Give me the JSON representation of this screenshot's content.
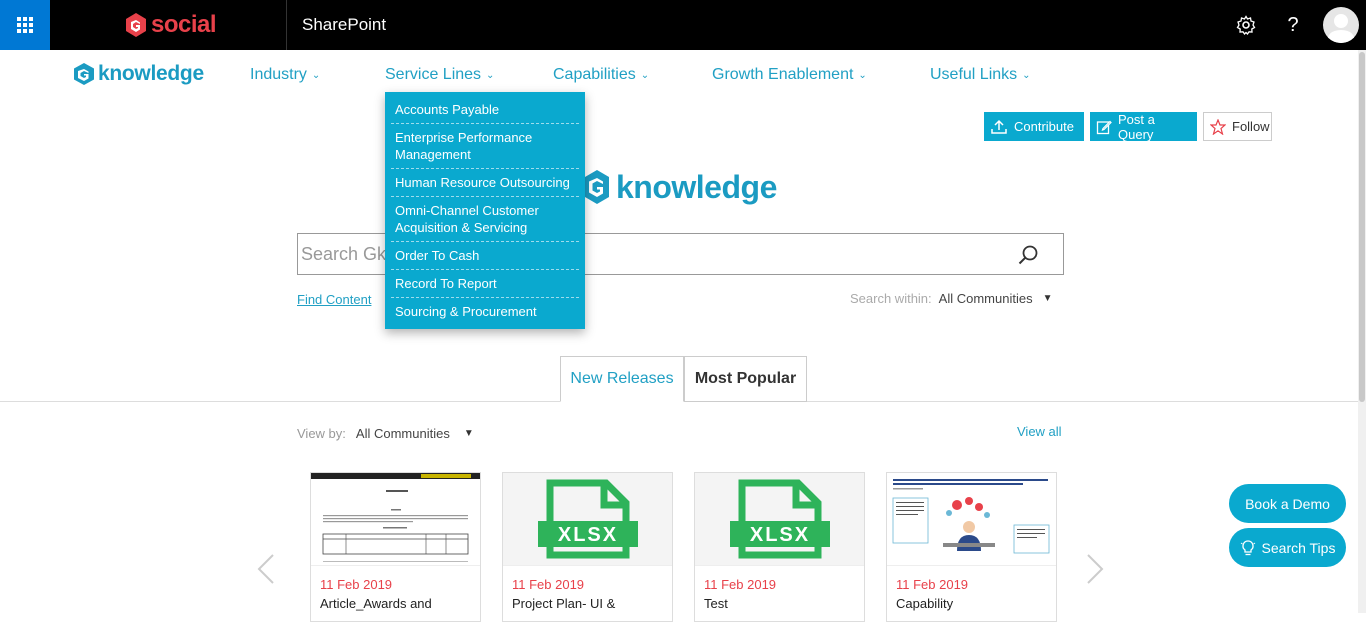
{
  "suitebar": {
    "brand": "social",
    "app_title": "SharePoint"
  },
  "nav": {
    "logo_text": "knowledge",
    "items": [
      {
        "label": "Industry"
      },
      {
        "label": "Service Lines"
      },
      {
        "label": "Capabilities"
      },
      {
        "label": "Growth Enablement"
      },
      {
        "label": "Useful Links"
      }
    ]
  },
  "dropdown": {
    "items": [
      "Accounts Payable",
      "Enterprise Performance Management",
      "Human Resource Outsourcing",
      "Omni-Channel Customer Acquisition & Servicing",
      "Order To Cash",
      "Record To Report",
      "Sourcing & Procurement"
    ]
  },
  "actions": {
    "contribute": "Contribute",
    "post_query": "Post a Query",
    "follow": "Follow"
  },
  "hero": {
    "logo_text": "knowledge"
  },
  "search": {
    "placeholder": "Search Gknowledge",
    "find_content": "Find Content",
    "within_label": "Search within:",
    "within_value": "All Communities"
  },
  "tabs": [
    {
      "label": "New Releases",
      "active": true
    },
    {
      "label": "Most Popular",
      "active": false
    }
  ],
  "listing": {
    "view_by_label": "View by:",
    "view_by_value": "All Communities",
    "view_all": "View all"
  },
  "cards": [
    {
      "date": "11 Feb 2019",
      "title": "Article_Awards and",
      "thumb": "document"
    },
    {
      "date": "11 Feb 2019",
      "title": "Project Plan- UI &",
      "thumb": "xlsx"
    },
    {
      "date": "11 Feb 2019",
      "title": "Test",
      "thumb": "xlsx"
    },
    {
      "date": "11 Feb 2019",
      "title": "Capability",
      "thumb": "infographic"
    }
  ],
  "xlsx_label": "XLSX",
  "floating": {
    "book_demo": "Book a Demo",
    "search_tips": "Search Tips"
  },
  "colors": {
    "accent": "#0aa9cf",
    "link": "#21a0c4",
    "brand_red": "#e8414a",
    "suitebar": "#000000",
    "waffle": "#0078d4"
  },
  "icons": [
    "waffle-icon",
    "settings-gear-icon",
    "help-icon",
    "search-icon",
    "upload-icon",
    "edit-icon",
    "star-icon",
    "lightbulb-icon",
    "chevron-left-icon",
    "chevron-right-icon"
  ]
}
